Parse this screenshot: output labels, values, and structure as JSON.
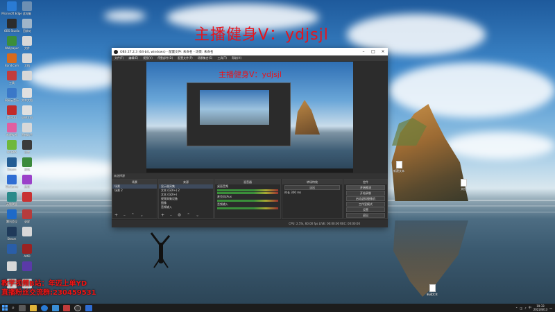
{
  "overlay": {
    "top_text": "主播健身V：ydjsjl",
    "bottom_line1": "教学视频B站：年迈上单YD",
    "bottom_line2": "直播粉丝交流群:230459531"
  },
  "desktop_icons_left": [
    {
      "label": "Microsoft Edge",
      "color": "#2a7bd4"
    },
    {
      "label": "此电脑",
      "color": "#6d8fb3"
    },
    {
      "label": "OBS Studio",
      "color": "#2c2c2c"
    },
    {
      "label": "回收站",
      "color": "#9fb5c9"
    },
    {
      "label": "Wallpaper",
      "color": "#3b8e3b"
    },
    {
      "label": "文件",
      "color": "#d8d8d8"
    },
    {
      "label": "Bandicam",
      "color": "#d66a1d"
    },
    {
      "label": "文档",
      "color": "#d8d8d8"
    },
    {
      "label": "工具",
      "color": "#c23c3c"
    },
    {
      "label": "",
      "color": "#d8d8d8"
    },
    {
      "label": "网易云音乐",
      "color": "#3a78c8"
    },
    {
      "label": "文本文档",
      "color": "#e0e0e0"
    },
    {
      "label": "腾讯QQ",
      "color": "#c02a2a"
    },
    {
      "label": "说明文档",
      "color": "#e0e0e0"
    },
    {
      "label": "哔哩哔哩",
      "color": "#e05fa1"
    },
    {
      "label": "直播助手",
      "color": "#d8d8d8"
    },
    {
      "label": "NVIDIA",
      "color": "#6fb83b"
    },
    {
      "label": "设置",
      "color": "#3b3b3b"
    },
    {
      "label": "Steam",
      "color": "#245d94"
    },
    {
      "label": "游戏",
      "color": "#3c8a3c"
    },
    {
      "label": "WeGame",
      "color": "#2f6dd3"
    },
    {
      "label": "应用",
      "color": "#9b41c9"
    },
    {
      "label": "英雄联盟",
      "color": "#2b8a8a"
    },
    {
      "label": "",
      "color": "#c83232"
    },
    {
      "label": "腾讯会议",
      "color": "#1e6ac8"
    },
    {
      "label": "录屏",
      "color": "#b63c3c"
    },
    {
      "label": "Steam",
      "color": "#1f3a5a"
    },
    {
      "label": "",
      "color": "#d8d8d8"
    },
    {
      "label": "",
      "color": "#2a5ea8"
    },
    {
      "label": "AMD",
      "color": "#9a2222"
    },
    {
      "label": "",
      "color": "#d8d8d8"
    },
    {
      "label": "",
      "color": "#5a3aa8"
    },
    {
      "label": "",
      "color": "#d8d8d8"
    },
    {
      "label": "",
      "color": "#d8d8d8"
    }
  ],
  "desktop_files_right": [
    {
      "label": "新建文本"
    },
    {
      "label": "文档"
    },
    {
      "label": "新建文本"
    }
  ],
  "obs": {
    "title": "OBS 27.2.3 (64-bit, windows) - 配置文件: 未命名 - 场景: 未命名",
    "menu": [
      "文件(F)",
      "编辑(E)",
      "视图(V)",
      "停靠部件(D)",
      "配置文件(P)",
      "场景集合(S)",
      "工具(T)",
      "帮助(H)"
    ],
    "preview_overlay_text": "主播健身V：ydjsjl",
    "no_source_label": "未选择源",
    "docks": {
      "scenes": {
        "header": "场景",
        "items": [
          "场景",
          "场景 2"
        ]
      },
      "sources": {
        "header": "来源",
        "items": [
          "显示器采集",
          "文本 (GDI+) 2",
          "文本 (GDI+)",
          "视频采集设备",
          "图像",
          "音频输入"
        ]
      },
      "mixer": {
        "header": "混音器",
        "channels": [
          "桌面音频",
          "麦克风/Aux",
          "音频输入"
        ]
      },
      "transitions": {
        "header": "转场特效",
        "fade": "淡出",
        "duration_label": "时长",
        "duration": "300 ms"
      },
      "controls": {
        "header": "控件",
        "buttons": [
          "开始推流",
          "开始录制",
          "启动虚拟摄像机",
          "工作室模式",
          "设置",
          "退出"
        ]
      }
    },
    "status": "CPU: 2.5%, 60.00 fps    LIVE: 00:00:00    REC: 00:00:00"
  },
  "taskbar": {
    "time": "19:33",
    "date": "2022/8/13",
    "tray_text": "中"
  }
}
